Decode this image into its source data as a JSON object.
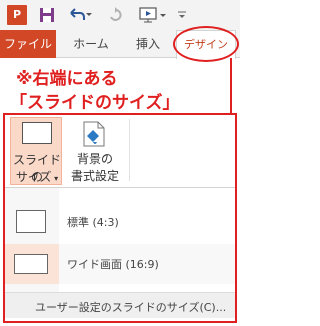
{
  "qat": {
    "app_icon_letter": "P",
    "icons": [
      "powerpoint-logo-icon",
      "save-icon",
      "undo-icon",
      "redo-icon",
      "present-from-start-icon",
      "customize-toolbar-icon"
    ]
  },
  "tabs": {
    "file": "ファイル",
    "home": "ホーム",
    "insert": "挿入",
    "design": "デザイン"
  },
  "annotation": {
    "line1": "※右端にある",
    "line2": "「スライドのサイズ」",
    "color": "#e02020"
  },
  "ribbon": {
    "slide_size_line1": "スライドの",
    "slide_size_line2": "サイズ",
    "format_bg_line1": "背景の",
    "format_bg_line2": "書式設定"
  },
  "menu": {
    "items": [
      {
        "label": "標準 (4:3)"
      },
      {
        "label": "ワイド画面 (16:9)"
      }
    ],
    "custom_label": "ユーザー設定のスライドのサイズ(C)..."
  },
  "colors": {
    "brand": "#d24726",
    "highlight": "#fbd9c9"
  }
}
